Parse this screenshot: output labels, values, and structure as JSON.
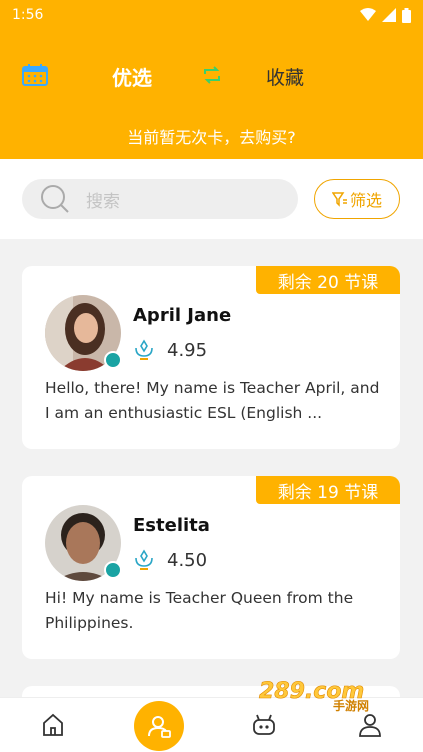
{
  "status": {
    "time": "1:56"
  },
  "header": {
    "tab_active": "优选",
    "tab_inactive": "收藏",
    "buy_hint": "当前暂无次卡，去购买?"
  },
  "search": {
    "placeholder": "搜索",
    "filter_label": "筛选"
  },
  "teachers": [
    {
      "badge": "剩余 20 节课",
      "name": "April Jane",
      "rating": "4.95",
      "intro": "Hello, there! My name is Teacher April, and I am an enthusiastic ESL (English ..."
    },
    {
      "badge": "剩余 19 节课",
      "name": "Estelita",
      "rating": "4.50",
      "intro": "Hi! My name is Teacher Queen from the Philippines."
    }
  ],
  "tabbar": {
    "items": [
      "home-icon",
      "teacher-icon",
      "robot-icon",
      "profile-icon"
    ]
  },
  "watermark": {
    "text": "289.com",
    "sub": "手游网"
  },
  "colors": {
    "accent": "#ffb200",
    "online": "#1aa3a3",
    "bg": "#f2f2f2"
  }
}
